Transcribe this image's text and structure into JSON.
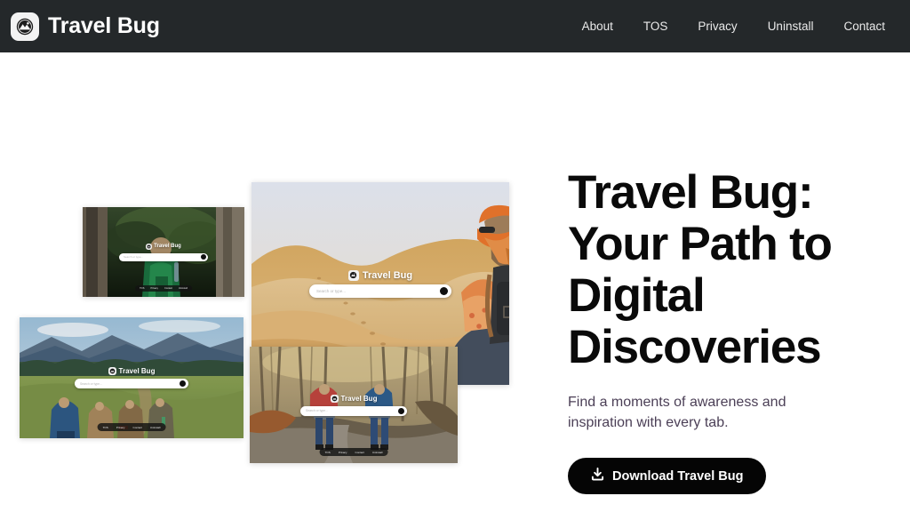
{
  "header": {
    "brand": {
      "name": "Travel Bug",
      "icon": "mountain-circle-logo"
    },
    "nav": [
      {
        "label": "About"
      },
      {
        "label": "TOS"
      },
      {
        "label": "Privacy"
      },
      {
        "label": "Uninstall"
      },
      {
        "label": "Contact"
      }
    ]
  },
  "hero": {
    "title": "Travel Bug: Your Path to Digital Discoveries",
    "subtitle": "Find a moments of awareness and inspiration with every tab.",
    "cta_label": "Download Travel Bug",
    "cta_icon": "download-icon"
  },
  "newtab_mock": {
    "brand": "Travel Bug",
    "search_placeholder": "Search or type...",
    "search_button_icon": "search-circle-icon",
    "footer_links": [
      "TOS",
      "Privacy",
      "Contact",
      "Uninstall"
    ]
  },
  "screenshots": [
    {
      "id": "forest",
      "alt": "Hiker with green backpack walking through a forest"
    },
    {
      "id": "desert",
      "alt": "Woman with backpack sitting on a sand dune in the desert"
    },
    {
      "id": "meadow",
      "alt": "Group of backpackers hiking a meadow trail toward mountains"
    },
    {
      "id": "trail",
      "alt": "Two hikers with red and blue backpacks on an autumn forest trail"
    }
  ],
  "colors": {
    "header_bg": "#24282a",
    "page_bg": "#ffffff",
    "title": "#0a0a0a",
    "subtitle": "#4b3f56",
    "cta_bg": "#050505"
  }
}
